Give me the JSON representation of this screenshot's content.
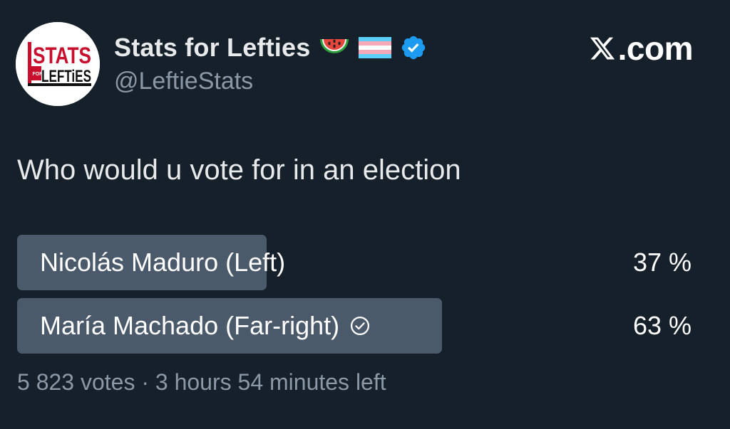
{
  "author": {
    "display_name": "Stats for Lefties",
    "handle": "@LeftieStats",
    "avatar_text_top": "STATS",
    "avatar_text_for": "FOR",
    "avatar_text_bottom": "LEFTiES",
    "badges": [
      "watermelon-emoji",
      "transgender-flag-emoji",
      "verified-badge-icon"
    ],
    "verified_color": "#1d9bf0"
  },
  "brand": {
    "label": ".com",
    "logo": "x-logo-icon"
  },
  "tweet": {
    "text": "Who would u vote for in an election"
  },
  "poll": {
    "options": [
      {
        "label": "Nicolás Maduro (Left)",
        "percent_label": "37 %",
        "fraction": 0.37,
        "winner": false
      },
      {
        "label": "María Machado (Far-right)",
        "percent_label": "63 %",
        "fraction": 0.63,
        "winner": true
      }
    ],
    "meta": "5 823 votes · 3 hours 54 minutes left",
    "bar_color": "#4b5a6b"
  },
  "colors": {
    "background": "#15202b",
    "text_primary": "#e7e9ea",
    "text_secondary": "#8b98a5"
  }
}
